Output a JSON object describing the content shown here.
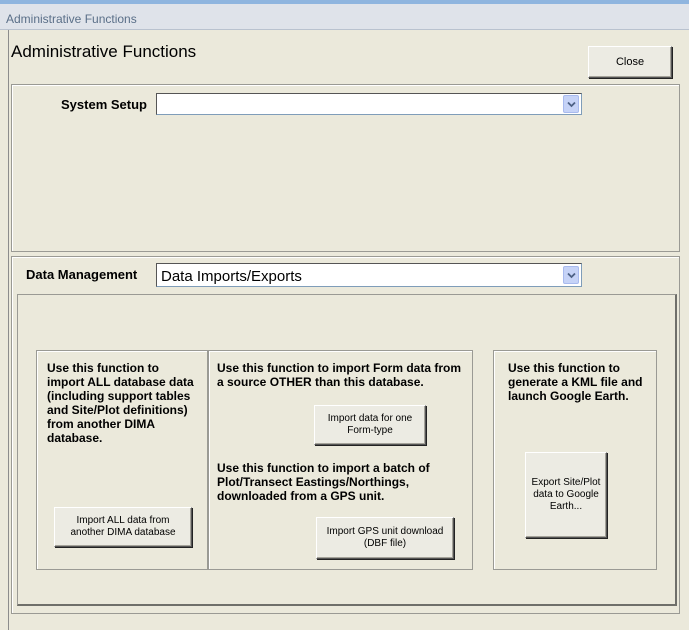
{
  "window": {
    "title": "Administrative Functions"
  },
  "form": {
    "heading": "Administrative Functions",
    "close_label": "Close"
  },
  "system_setup": {
    "label": "System Setup",
    "value": ""
  },
  "data_management": {
    "label": "Data Management",
    "value": "Data Imports/Exports"
  },
  "sections": {
    "import_all": {
      "description": "Use this function to import ALL database data (including support tables and Site/Plot definitions) from another DIMA database.",
      "button_label": "Import ALL data from another DIMA database"
    },
    "import_form": {
      "description": "Use this function to import Form data from a source OTHER than this database.",
      "button_label": "Import data for one Form-type"
    },
    "import_gps": {
      "description": "Use this function to import a batch of Plot/Transect Eastings/Northings, downloaded from a GPS unit.",
      "button_label": "Import GPS unit download (DBF file)"
    },
    "export_kml": {
      "description": "Use this function to generate a KML file and launch Google Earth.",
      "button_label": "Export Site/Plot data to Google Earth..."
    }
  }
}
